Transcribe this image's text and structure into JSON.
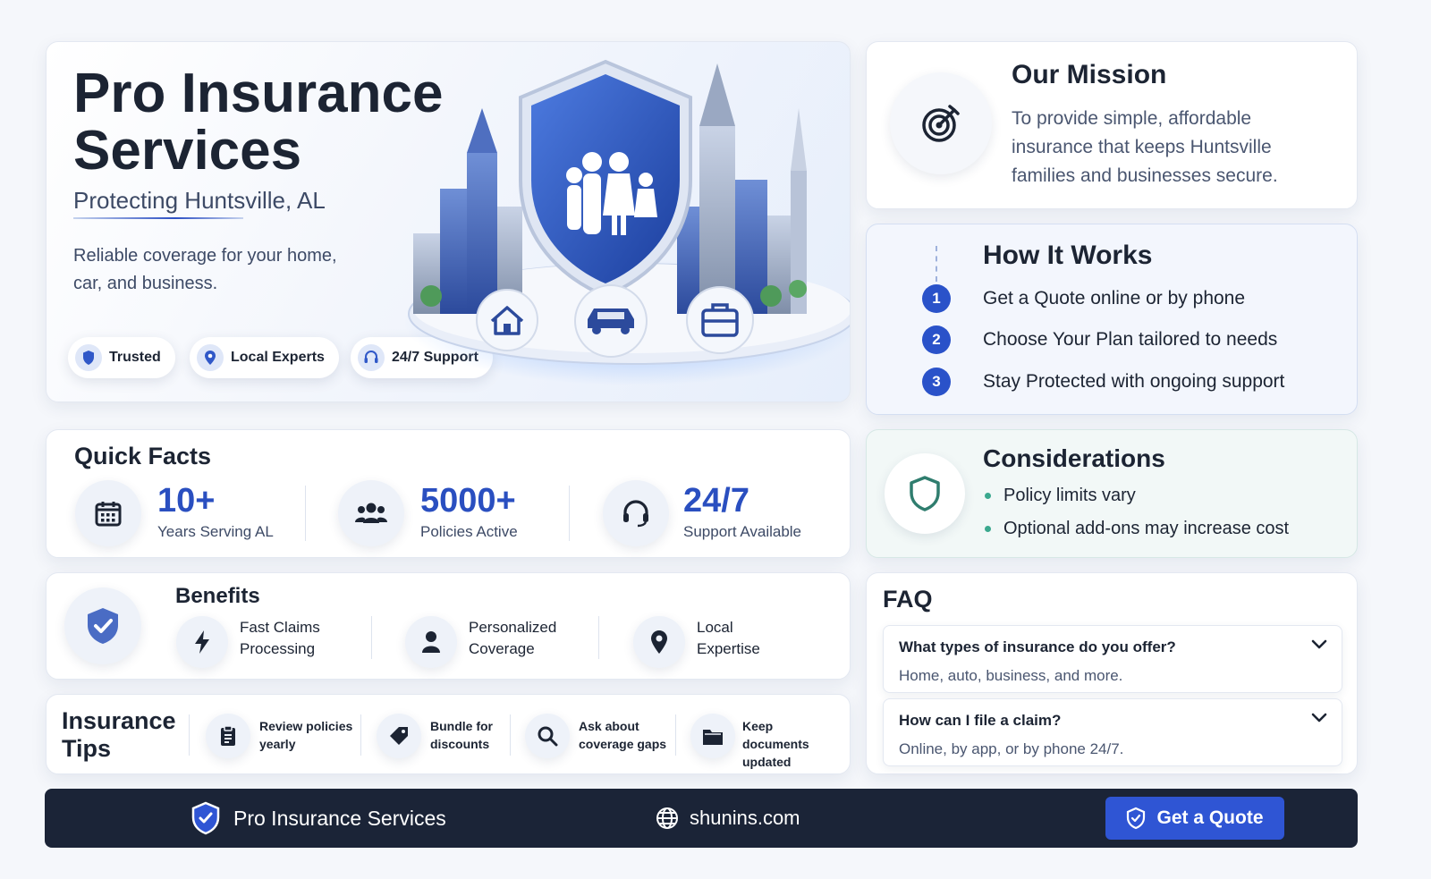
{
  "hero": {
    "title": "Pro Insurance Services",
    "subtitle": "Protecting Huntsville, AL",
    "description": "Reliable coverage for your home, car, and business.",
    "badges": [
      {
        "label": "Trusted",
        "icon": "shield-icon"
      },
      {
        "label": "Local Experts",
        "icon": "location-pin-icon"
      },
      {
        "label": "24/7 Support",
        "icon": "headset-icon"
      }
    ],
    "illustration_icons": [
      "family-shield-icon",
      "home-icon",
      "car-icon",
      "briefcase-icon"
    ]
  },
  "mission": {
    "title": "Our Mission",
    "text": "To provide simple, affordable insurance that keeps Huntsville families and businesses secure.",
    "icon": "target-icon"
  },
  "how_it_works": {
    "title": "How It Works",
    "steps": [
      {
        "number": "1",
        "text": "Get a Quote online or by phone"
      },
      {
        "number": "2",
        "text": "Choose Your Plan tailored to needs"
      },
      {
        "number": "3",
        "text": "Stay Protected with ongoing support"
      }
    ]
  },
  "considerations": {
    "title": "Considerations",
    "icon": "shield-outline-icon",
    "items": [
      "Policy limits vary",
      "Optional add-ons may increase cost"
    ]
  },
  "quick_facts": {
    "title": "Quick Facts",
    "facts": [
      {
        "value": "10+",
        "label": "Years Serving AL",
        "icon": "calendar-icon"
      },
      {
        "value": "5000+",
        "label": "Policies Active",
        "icon": "users-icon"
      },
      {
        "value": "24/7",
        "label": "Support Available",
        "icon": "headset-icon"
      }
    ]
  },
  "benefits": {
    "title": "Benefits",
    "icon": "shield-check-icon",
    "items": [
      {
        "label": "Fast Claims Processing",
        "icon": "lightning-icon"
      },
      {
        "label": "Personalized Coverage",
        "icon": "person-icon"
      },
      {
        "label": "Local Expertise",
        "icon": "location-pin-icon"
      }
    ]
  },
  "tips": {
    "title": "Insurance Tips",
    "items": [
      {
        "label": "Review policies yearly",
        "icon": "clipboard-icon"
      },
      {
        "label": "Bundle for discounts",
        "icon": "tag-icon"
      },
      {
        "label": "Ask about coverage gaps",
        "icon": "search-icon"
      },
      {
        "label": "Keep documents updated",
        "icon": "folder-icon"
      }
    ]
  },
  "faq": {
    "title": "FAQ",
    "items": [
      {
        "question": "What types of insurance do you offer?",
        "answer": "Home, auto, business, and more."
      },
      {
        "question": "How can I file a claim?",
        "answer": "Online, by app, or by phone 24/7."
      }
    ]
  },
  "footer": {
    "brand": "Pro Insurance Services",
    "website": "shunins.com",
    "cta": "Get a Quote"
  },
  "colors": {
    "accent": "#2a52c9",
    "dark": "#1b2437",
    "teal": "#3ba88e"
  }
}
